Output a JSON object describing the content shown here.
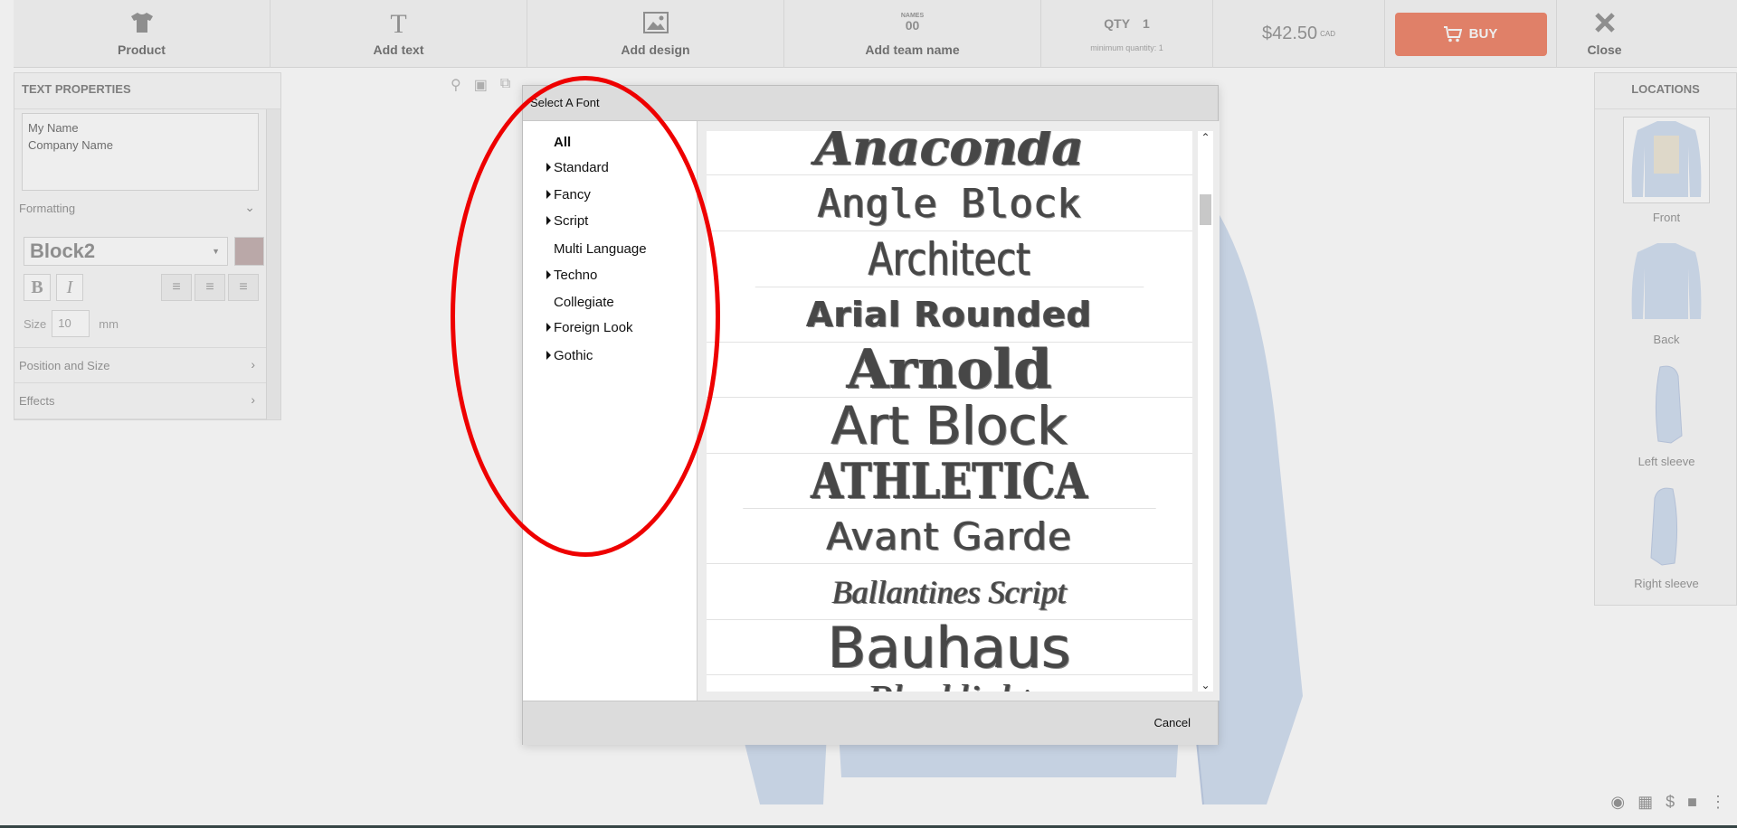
{
  "toolbar": {
    "product_label": "Product",
    "add_text_label": "Add text",
    "add_text_icon": "T",
    "add_design_label": "Add design",
    "add_team_label": "Add team name",
    "add_team_icon_caption": "NAMES",
    "add_team_icon_digits": "00",
    "qty_label": "QTY",
    "qty_value": "1",
    "min_qty": "minimum quantity: 1",
    "price": "$42.50",
    "currency": "CAD",
    "buy_label": "BUY",
    "close_label": "Close"
  },
  "text_properties": {
    "title": "TEXT PROPERTIES",
    "placeholder": "My Name\nCompany Name",
    "formatting_label": "Formatting",
    "font_value": "Block2",
    "bold_label": "B",
    "italic_label": "I",
    "size_label": "Size",
    "size_value": "10",
    "size_unit": "mm",
    "position_label": "Position and Size",
    "effects_label": "Effects",
    "swatch_color": "#c8b4b4"
  },
  "locations": {
    "title": "LOCATIONS",
    "items": [
      {
        "label": "Front"
      },
      {
        "label": "Back"
      },
      {
        "label": "Left sleeve"
      },
      {
        "label": "Right sleeve"
      }
    ]
  },
  "dialog": {
    "title": "Select A Font",
    "cancel_label": "Cancel",
    "categories": [
      {
        "label": "All",
        "expandable": false
      },
      {
        "label": "Standard",
        "expandable": true
      },
      {
        "label": "Fancy",
        "expandable": true
      },
      {
        "label": "Script",
        "expandable": true
      },
      {
        "label": "Multi Language",
        "expandable": false
      },
      {
        "label": "Techno",
        "expandable": true
      },
      {
        "label": "Collegiate",
        "expandable": false
      },
      {
        "label": "Foreign Look",
        "expandable": true
      },
      {
        "label": "Gothic",
        "expandable": true
      }
    ],
    "fonts": [
      {
        "name": "Anaconda"
      },
      {
        "name": "Angle Block"
      },
      {
        "name": "Architect"
      },
      {
        "name": "Arial Rounded"
      },
      {
        "name": "Arnold"
      },
      {
        "name": "Art Block"
      },
      {
        "name": "ATHLETICA"
      },
      {
        "name": "Avant Garde"
      },
      {
        "name": "Ballantines Script"
      },
      {
        "name": "Bauhaus"
      },
      {
        "name": "Blocklight"
      }
    ]
  },
  "colors": {
    "buy_button": "#f08a70",
    "annotation": "#ee0000",
    "shirt": "#d4e0f2"
  }
}
